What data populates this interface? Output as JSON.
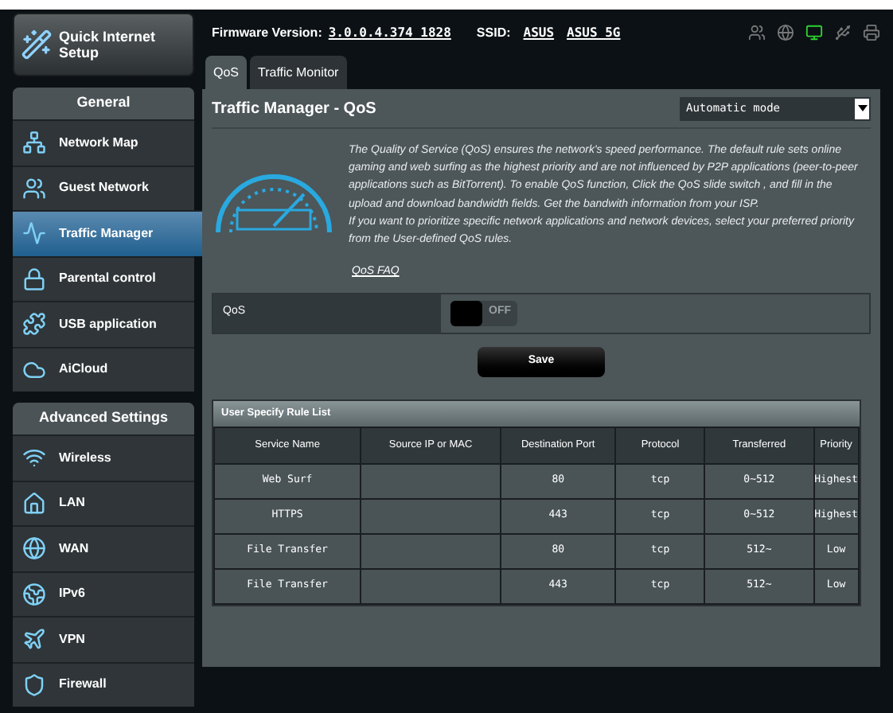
{
  "quick_setup": {
    "label": "Quick Internet Setup"
  },
  "sidebar": [
    {
      "title": "General",
      "items": [
        {
          "label": "Network Map",
          "kind": "map",
          "selected": false
        },
        {
          "label": "Guest Network",
          "kind": "guest",
          "selected": false
        },
        {
          "label": "Traffic Manager",
          "kind": "traffic",
          "selected": true
        },
        {
          "label": "Parental control",
          "kind": "lock",
          "selected": false
        },
        {
          "label": "USB application",
          "kind": "usb",
          "selected": false
        },
        {
          "label": "AiCloud",
          "kind": "cloud",
          "selected": false
        }
      ]
    },
    {
      "title": "Advanced Settings",
      "items": [
        {
          "label": "Wireless",
          "kind": "wifi",
          "selected": false
        },
        {
          "label": "LAN",
          "kind": "home",
          "selected": false
        },
        {
          "label": "WAN",
          "kind": "globe",
          "selected": false
        },
        {
          "label": "IPv6",
          "kind": "globe2",
          "selected": false
        },
        {
          "label": "VPN",
          "kind": "vpn",
          "selected": false
        },
        {
          "label": "Firewall",
          "kind": "shield",
          "selected": false
        }
      ]
    }
  ],
  "header": {
    "firmware_label": "Firmware Version:",
    "firmware": "3.0.0.4.374_1828",
    "ssid_label": "SSID:",
    "ssids": [
      "ASUS",
      "ASUS_5G"
    ]
  },
  "tabs": [
    {
      "label": "QoS",
      "selected": true
    },
    {
      "label": "Traffic Monitor",
      "selected": false
    }
  ],
  "panel": {
    "title": "Traffic Manager - QoS",
    "mode": "Automatic mode",
    "description": [
      "The Quality of Service (QoS) ensures the network's speed performance. The default rule sets online gaming and web surfing as the highest priority and are not influenced by P2P applications (peer-to-peer applications such as BitTorrent). To enable QoS function, Click the QoS slide switch , and fill in the upload and download bandwidth fields. Get the bandwith information from your ISP.",
      "If you want to prioritize specific network applications and network devices, select your preferred priority from the User-defined QoS rules."
    ],
    "faq_link": "QoS FAQ",
    "qos": {
      "label": "QoS",
      "on": false,
      "state_text": "OFF"
    },
    "save_button": "Save"
  },
  "table": {
    "title": "User Specify Rule List",
    "columns": [
      "Service Name",
      "Source IP or MAC",
      "Destination Port",
      "Protocol",
      "Transferred",
      "Priority"
    ],
    "rows": [
      [
        "Web Surf",
        "",
        "80",
        "tcp",
        "0~512",
        "Highest"
      ],
      [
        "HTTPS",
        "",
        "443",
        "tcp",
        "0~512",
        "Highest"
      ],
      [
        "File Transfer",
        "",
        "80",
        "tcp",
        "512~",
        "Low"
      ],
      [
        "File Transfer",
        "",
        "443",
        "tcp",
        "512~",
        "Low"
      ]
    ]
  }
}
